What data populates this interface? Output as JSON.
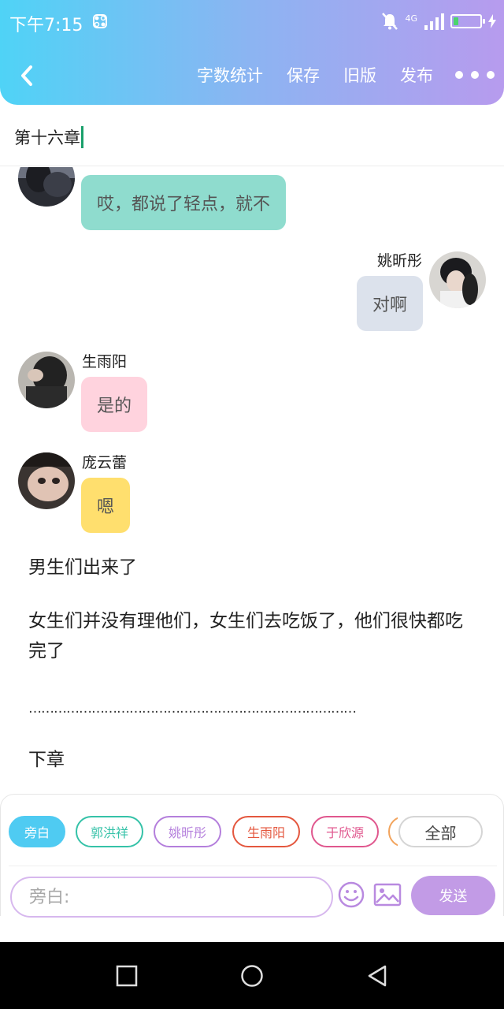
{
  "status_bar": {
    "time": "下午7:15",
    "network": "4G",
    "battery_percent": 20
  },
  "toolbar": {
    "word_count": "字数统计",
    "save": "保存",
    "old_version": "旧版",
    "publish": "发布"
  },
  "chapter": {
    "title": "第十六章"
  },
  "messages": [
    {
      "speaker": "",
      "text": "哎，都说了轻点，就不",
      "side": "left",
      "bubble_color": "#8fdcce"
    },
    {
      "speaker": "姚昕彤",
      "text": "对啊",
      "side": "right",
      "bubble_color": "#dce2ec"
    },
    {
      "speaker": "生雨阳",
      "text": "是的",
      "side": "left",
      "bubble_color": "#ffd3de"
    },
    {
      "speaker": "庞云蕾",
      "text": "嗯",
      "side": "left",
      "bubble_color": "#ffdf6e"
    }
  ],
  "narration": [
    "男生们出来了",
    "女生们并没有理他们，女生们去吃饭了，他们很快都吃完了",
    "……………………………………………………………………",
    "下章"
  ],
  "roles": [
    {
      "label": "旁白",
      "color": "#4fcbf2",
      "selected": true
    },
    {
      "label": "郭洪祥",
      "color": "#35c2a8",
      "selected": false
    },
    {
      "label": "姚昕彤",
      "color": "#b47fdc",
      "selected": false
    },
    {
      "label": "生雨阳",
      "color": "#e4573e",
      "selected": false
    },
    {
      "label": "于欣源",
      "color": "#e0578e",
      "selected": false
    }
  ],
  "roles_all": "全部",
  "input": {
    "placeholder": "旁白:"
  },
  "send_label": "发送",
  "colors": {
    "header_gradient_start": "#4fd3f6",
    "header_gradient_end": "#b79bee",
    "send_button": "#c29be6",
    "caret": "#1aa06b"
  }
}
